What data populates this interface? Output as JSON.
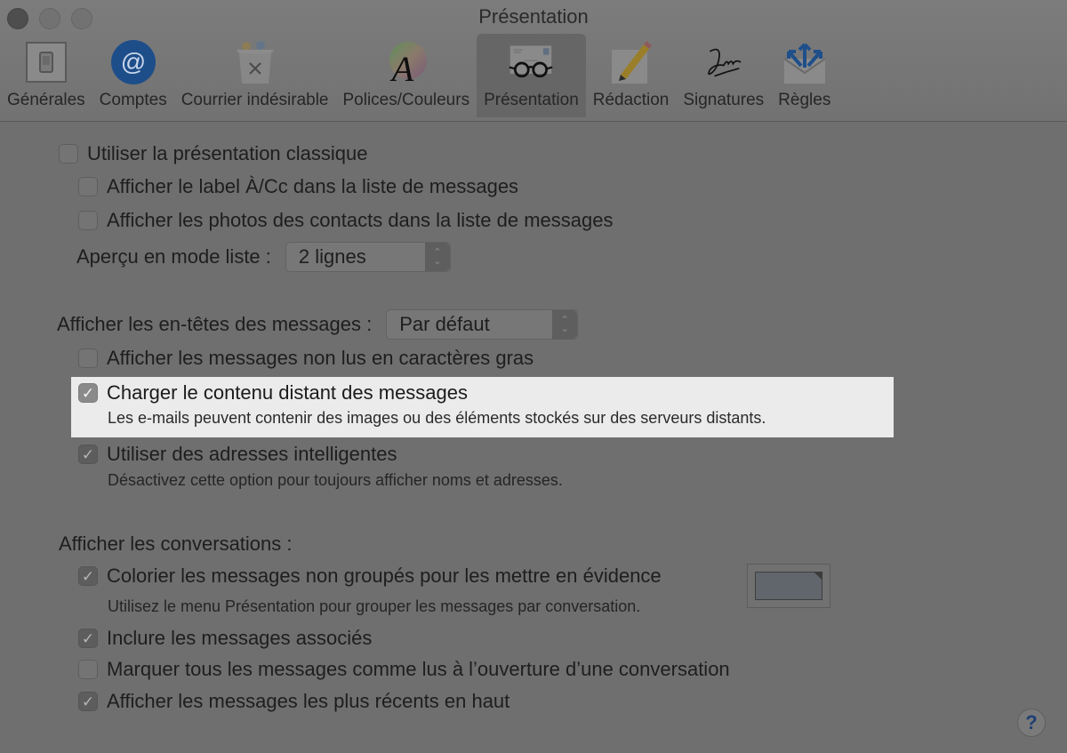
{
  "window": {
    "title": "Présentation"
  },
  "toolbar": {
    "items": [
      {
        "label": "Générales",
        "icon": "switch-icon",
        "active": false
      },
      {
        "label": "Comptes",
        "icon": "at-sign-icon",
        "active": false
      },
      {
        "label": "Courrier indésirable",
        "icon": "junk-trash-icon",
        "active": false
      },
      {
        "label": "Polices/Couleurs",
        "icon": "font-color-wheel-icon",
        "active": false
      },
      {
        "label": "Présentation",
        "icon": "glasses-letter-icon",
        "active": true
      },
      {
        "label": "Rédaction",
        "icon": "pencil-icon",
        "active": false
      },
      {
        "label": "Signatures",
        "icon": "signature-icon",
        "active": false
      },
      {
        "label": "Règles",
        "icon": "rules-envelope-icon",
        "active": false
      }
    ]
  },
  "settings": {
    "classic_layout": {
      "label": "Utiliser la présentation classique",
      "checked": false
    },
    "show_to_cc": {
      "label": "Afficher le label À/Cc dans la liste de messages",
      "checked": false
    },
    "show_contact_photos": {
      "label": "Afficher les photos des contacts dans la liste de messages",
      "checked": false
    },
    "list_preview": {
      "label": "Aperçu en mode liste :",
      "value": "2 lignes"
    },
    "headers": {
      "label": "Afficher les en-têtes des messages :",
      "value": "Par défaut"
    },
    "unread_bold": {
      "label": "Afficher les messages non lus en caractères gras",
      "checked": false
    },
    "load_remote": {
      "label": "Charger le contenu distant des messages",
      "checked": true,
      "description": "Les e-mails peuvent contenir des images ou des éléments stockés sur des serveurs distants."
    },
    "smart_addresses": {
      "label": "Utiliser des adresses intelligentes",
      "checked": true,
      "description": "Désactivez cette option pour toujours afficher noms et adresses."
    },
    "conversations_header": "Afficher les conversations :",
    "color_ungrouped": {
      "label": "Colorier les messages non groupés pour les mettre en évidence",
      "checked": true,
      "description": "Utilisez le menu Présentation pour grouper les messages par conversation.",
      "color": "#61656c"
    },
    "include_related": {
      "label": "Inclure les messages associés",
      "checked": true
    },
    "mark_all_read": {
      "label": "Marquer tous les messages comme lus à l’ouverture d’une conversation",
      "checked": false
    },
    "newest_on_top": {
      "label": "Afficher les messages les plus récents en haut",
      "checked": true
    }
  },
  "help": {
    "label": "?"
  },
  "checkmark": "✓",
  "popup_arrows": {
    "up": "⌃",
    "down": "⌄"
  }
}
